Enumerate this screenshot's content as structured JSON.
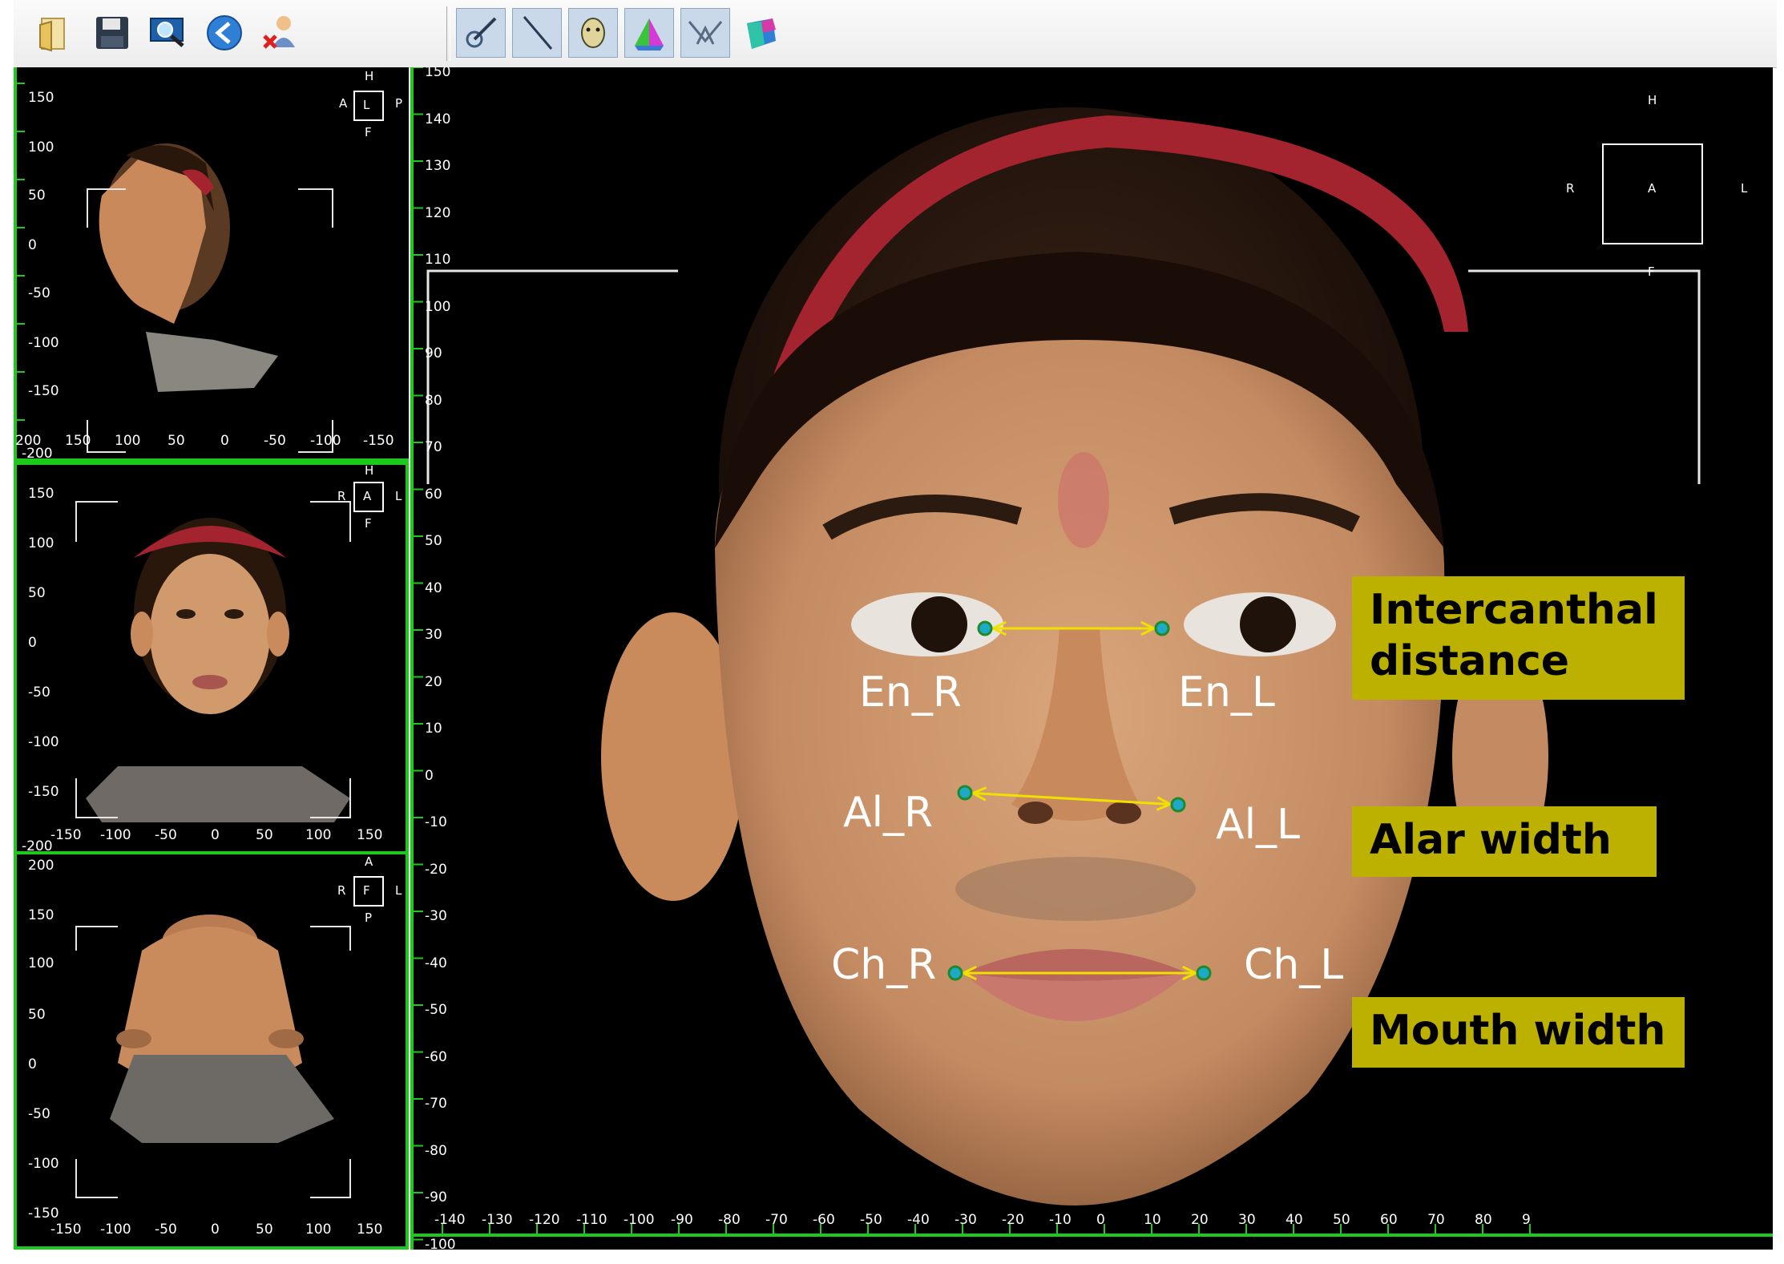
{
  "toolbar": {
    "buttons": [
      {
        "name": "open-file-button",
        "icon": "folder-icon"
      },
      {
        "name": "save-button",
        "icon": "floppy-disk-icon"
      },
      {
        "name": "view-monitor-button",
        "icon": "monitor-magnifier-icon"
      },
      {
        "name": "back-button",
        "icon": "back-arrow-icon"
      },
      {
        "name": "delete-user-button",
        "icon": "user-delete-icon"
      },
      {
        "name": "landmark-tool-button",
        "icon": "pen-target-icon",
        "pressed": true
      },
      {
        "name": "line-tool-button",
        "icon": "line-icon",
        "pressed": true
      },
      {
        "name": "face-tool-button",
        "icon": "face-icon",
        "pressed": true
      },
      {
        "name": "color-map-button",
        "icon": "color-prism-icon",
        "pressed": true
      },
      {
        "name": "wireframe-button",
        "icon": "wireframe-icon",
        "pressed": true
      },
      {
        "name": "surface-button",
        "icon": "surface-icon"
      }
    ]
  },
  "views": {
    "lateral": {
      "orient": {
        "top": "H",
        "left": "A",
        "center": "L",
        "right": "P",
        "bottom": "F"
      },
      "y_ticks": [
        "150",
        "100",
        "50",
        "0",
        "-50",
        "-100",
        "-150"
      ],
      "x_ticks": [
        "200",
        "150",
        "100",
        "50",
        "0",
        "-50",
        "-100",
        "-150"
      ],
      "corner_label": "-200"
    },
    "frontal": {
      "orient": {
        "top": "H",
        "left": "R",
        "center": "A",
        "right": "L",
        "bottom": "F"
      },
      "y_ticks": [
        "150",
        "100",
        "50",
        "0",
        "-50",
        "-100",
        "-150"
      ],
      "x_ticks": [
        "-150",
        "-100",
        "-50",
        "0",
        "50",
        "100",
        "150"
      ],
      "corner_label": "-200"
    },
    "inferior": {
      "orient": {
        "top": "A",
        "left": "R",
        "center": "F",
        "right": "L",
        "bottom": "P"
      },
      "y_ticks": [
        "200",
        "150",
        "100",
        "50",
        "0",
        "-50",
        "-100",
        "-150"
      ],
      "x_ticks": [
        "-150",
        "-100",
        "-50",
        "0",
        "50",
        "100",
        "150"
      ]
    }
  },
  "main": {
    "orient": {
      "top": "H",
      "left": "R",
      "center": "A",
      "right": "L",
      "bottom": "F"
    },
    "y_ticks": [
      "150",
      "140",
      "130",
      "120",
      "110",
      "100",
      "90",
      "80",
      "70",
      "60",
      "50",
      "40",
      "30",
      "20",
      "10",
      "0",
      "-10",
      "-20",
      "-30",
      "-40",
      "-50",
      "-60",
      "-70",
      "-80",
      "-90",
      "-100"
    ],
    "x_ticks": [
      "-140",
      "-130",
      "-120",
      "-110",
      "-100",
      "-90",
      "-80",
      "-70",
      "-60",
      "-50",
      "-40",
      "-30",
      "-20",
      "-10",
      "0",
      "10",
      "20",
      "30",
      "40",
      "50",
      "60",
      "70",
      "80",
      "9"
    ],
    "landmarks": {
      "en_r": "En_R",
      "en_l": "En_L",
      "al_r": "Al_R",
      "al_l": "Al_L",
      "ch_r": "Ch_R",
      "ch_l": "Ch_L"
    },
    "callouts": {
      "intercanthal": "Intercanthal distance",
      "alar": "Alar width",
      "mouth": "Mouth width"
    },
    "colors": {
      "measure_line": "#f0e000",
      "landmark_fill": "#1fa9c9",
      "landmark_ring": "#1f8a2a",
      "callout_bg": "#bdb100",
      "grid_green": "#1ec81e"
    }
  }
}
